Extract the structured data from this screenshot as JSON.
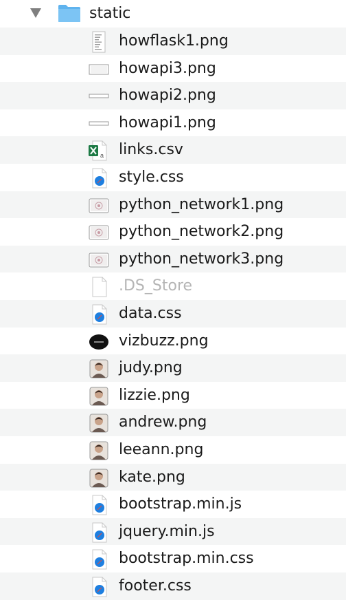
{
  "folder": {
    "name": "static",
    "icon": "folder-icon",
    "expanded": true
  },
  "files": [
    {
      "name": "howflask1.png",
      "icon": "text-image-icon",
      "dim": false
    },
    {
      "name": "howapi3.png",
      "icon": "wide-image-icon",
      "dim": false
    },
    {
      "name": "howapi2.png",
      "icon": "thin-image-icon",
      "dim": false
    },
    {
      "name": "howapi1.png",
      "icon": "thin-image-icon",
      "dim": false
    },
    {
      "name": "links.csv",
      "icon": "excel-icon",
      "dim": false
    },
    {
      "name": "style.css",
      "icon": "safari-doc-icon",
      "dim": false
    },
    {
      "name": "python_network1.png",
      "icon": "network-image-icon",
      "dim": false
    },
    {
      "name": "python_network2.png",
      "icon": "network-image-icon",
      "dim": false
    },
    {
      "name": "python_network3.png",
      "icon": "network-image-icon",
      "dim": false
    },
    {
      "name": ".DS_Store",
      "icon": "blank-doc-icon",
      "dim": true
    },
    {
      "name": "data.css",
      "icon": "safari-doc-icon",
      "dim": false
    },
    {
      "name": "vizbuzz.png",
      "icon": "vizbuzz-logo-icon",
      "dim": false
    },
    {
      "name": "judy.png",
      "icon": "portrait-icon",
      "dim": false
    },
    {
      "name": "lizzie.png",
      "icon": "portrait-icon",
      "dim": false
    },
    {
      "name": "andrew.png",
      "icon": "portrait-icon",
      "dim": false
    },
    {
      "name": "leeann.png",
      "icon": "portrait-icon",
      "dim": false
    },
    {
      "name": "kate.png",
      "icon": "portrait-icon",
      "dim": false
    },
    {
      "name": "bootstrap.min.js",
      "icon": "safari-doc-icon",
      "dim": false
    },
    {
      "name": "jquery.min.js",
      "icon": "safari-doc-icon",
      "dim": false
    },
    {
      "name": "bootstrap.min.css",
      "icon": "safari-doc-icon",
      "dim": false
    },
    {
      "name": "footer.css",
      "icon": "safari-doc-icon",
      "dim": false
    }
  ],
  "colors": {
    "stripe": "#f4f5f5",
    "folder": "#5fb3ee",
    "dim_text": "#b5b5b5",
    "accent": "#1e7fe0"
  }
}
